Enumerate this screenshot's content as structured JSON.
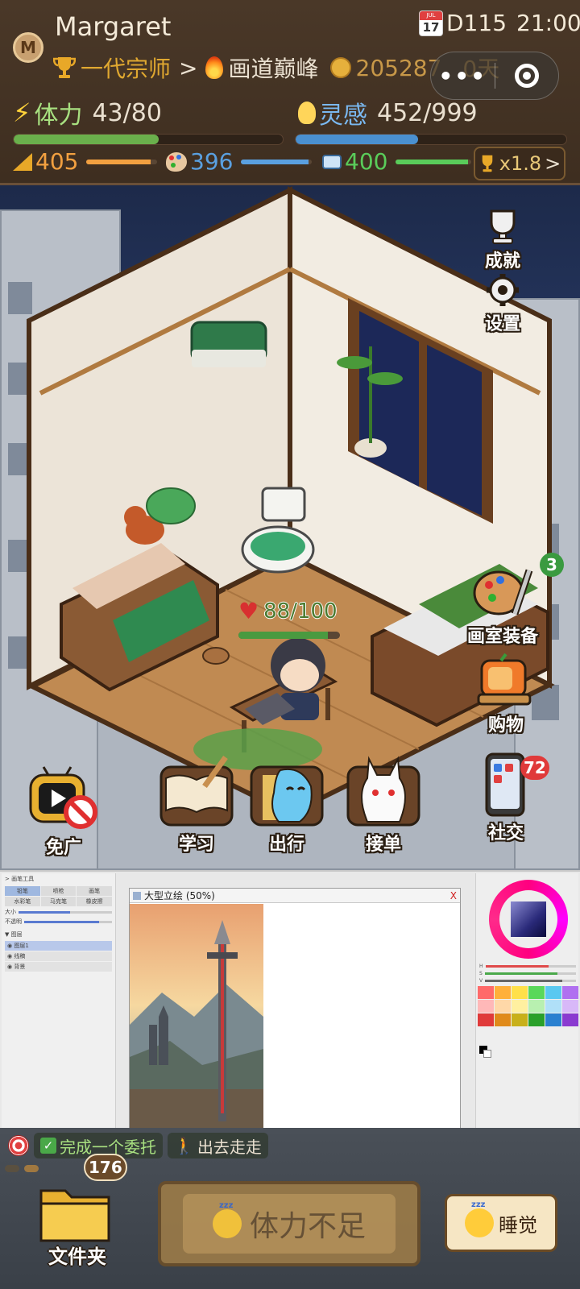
{
  "player": {
    "avatar_letter": "M",
    "name": "Margaret"
  },
  "calendar": {
    "month": "JUL",
    "day": "17",
    "game_day": "D115",
    "time": "21:00"
  },
  "rank": {
    "current": "一代宗师",
    "arrow": ">",
    "next": "画道巅峰"
  },
  "coins": {
    "amount": "205287",
    "extra": "0天"
  },
  "stamina": {
    "label": "体力",
    "value": "43/80",
    "current": 43,
    "max": 80,
    "color": "#6ab04c"
  },
  "inspiration": {
    "label": "灵感",
    "value": "452/999",
    "current": 452,
    "max": 999,
    "color": "#4a90d0"
  },
  "attributes": [
    {
      "value": "405",
      "bar_fraction": 0.9,
      "color": "#f2a040"
    },
    {
      "value": "396",
      "bar_fraction": 0.95,
      "color": "#5aa0e0"
    },
    {
      "value": "400",
      "bar_fraction": 0.95,
      "color": "#5acc5a"
    }
  ],
  "multiplier": {
    "label": "x1.8",
    "chevron": ">"
  },
  "side_buttons": {
    "achievements": "成就",
    "settings": "设置",
    "studio_gear": "画室装备",
    "studio_gear_badge": "3",
    "shop": "购物",
    "social": "社交",
    "social_badge": "72"
  },
  "hp": {
    "value": "88/100",
    "fraction": 0.88
  },
  "action_buttons": [
    {
      "label": "免广"
    },
    {
      "label": "学习"
    },
    {
      "label": "出行"
    },
    {
      "label": "接单"
    }
  ],
  "paint_app": {
    "tools_header": "> 画笔工具",
    "tools": [
      "铅笔",
      "喷枪",
      "画笔",
      "水彩笔",
      "马克笔",
      "橡皮擦"
    ],
    "size_label": "大小",
    "opacity_label": "不透明",
    "layers_header": "▼ 图层",
    "layers": [
      "◉ 图层1",
      "◉ 线稿",
      "◉ 背景"
    ],
    "doc_title": "大型立绘 (50%)",
    "doc_close": "X",
    "hsv": [
      "H",
      "S",
      "V"
    ],
    "swatches": [
      "#ff6a6a",
      "#ffb03a",
      "#ffe04a",
      "#5ad85a",
      "#5ac8f0",
      "#b070f0",
      "#ffb8b8",
      "#ffd8a8",
      "#fff0a0",
      "#b8f0b0",
      "#b0e0f8",
      "#d8b8f8",
      "#e03a3a",
      "#e08a1a",
      "#c8b01a",
      "#2aa02a",
      "#2a80d0",
      "#8a3ad0"
    ]
  },
  "tasks": [
    {
      "label": "完成一个委托",
      "checked": true
    },
    {
      "label": "出去走走",
      "checked": false
    }
  ],
  "folder": {
    "label": "文件夹",
    "badge": "176"
  },
  "main_button": {
    "label": "体力不足"
  },
  "sleep_button": {
    "label": "睡觉"
  }
}
